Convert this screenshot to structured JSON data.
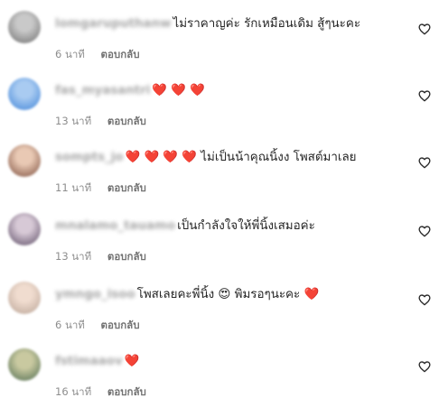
{
  "comments": [
    {
      "username": "lomgaruputhanw",
      "text": "ไม่ราคาญค่ะ รักเหมือนเดิม สู้ๆนะคะ",
      "time": "6 นาที",
      "reply": "ตอบกลับ",
      "avatar_colors": [
        "#c9c9c9",
        "#6d6d6d"
      ]
    },
    {
      "username": "fas_myasantri",
      "text": "❤️ ❤️ ❤️",
      "time": "13 นาที",
      "reply": "ตอบกลับ",
      "avatar_colors": [
        "#a9cbf1",
        "#3f84d8"
      ]
    },
    {
      "username": "sompts_jo",
      "text": "❤️ ❤️ ❤️ ❤️ ไม่เป็นน้าคุณนิ้งง โพสต์มาเลย",
      "time": "11 นาที",
      "reply": "ตอบกลับ",
      "avatar_colors": [
        "#e9c9b4",
        "#7a4c3c"
      ]
    },
    {
      "username": "mnalamo_tauamo",
      "text": "เป็นกำลังใจให้พี่นิ้งเสมอค่ะ",
      "time": "13 นาที",
      "reply": "ตอบกลับ",
      "avatar_colors": [
        "#d7c9d6",
        "#5a4a63"
      ]
    },
    {
      "username": "ymngo_isoo",
      "text": "โพสเลยคะพี่นิ้ง 😍 พิมรอๆนะคะ ❤️",
      "time": "6 นาที",
      "reply": "ตอบกลับ",
      "avatar_colors": [
        "#f0dccf",
        "#b8a395"
      ]
    },
    {
      "username": "fstimaaov",
      "text": "❤️",
      "time": "16 นาที",
      "reply": "ตอบกลับ",
      "avatar_colors": [
        "#c9c9a0",
        "#4c6a4f"
      ]
    }
  ],
  "icons": {
    "like": "heart-outline-icon"
  }
}
